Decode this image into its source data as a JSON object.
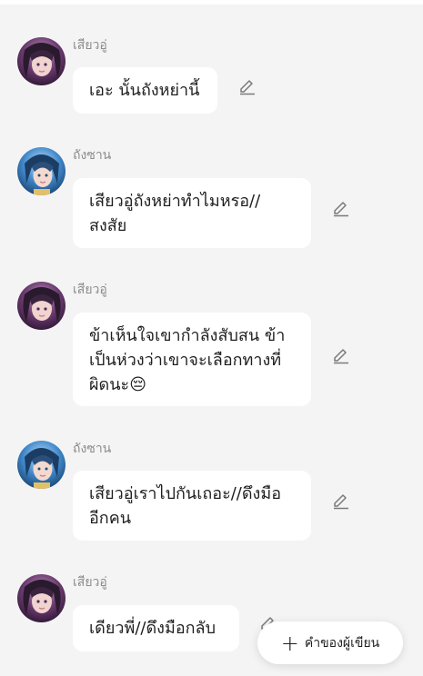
{
  "messages": [
    {
      "sender": "เสียวอู่",
      "avatar_icon": "purple-character-avatar-icon",
      "text": "เอะ นั้นถังหย่านี้"
    },
    {
      "sender": "ถังซาน",
      "avatar_icon": "blue-character-avatar-icon",
      "text": "เสียวอู่ถังหย่าทำไมหรอ// สงสัย"
    },
    {
      "sender": "เสียวอู่",
      "avatar_icon": "purple-character-avatar-icon",
      "text": "ข้าเห็นใจเขากำลังสับสน ข้าเป็นห่วงว่าเขาจะเลือกทางที่ผิดนะ😔"
    },
    {
      "sender": "ถังซาน",
      "avatar_icon": "blue-character-avatar-icon",
      "text": "เสียวอู่เราไปกันเถอะ//ดึงมืออีกคน"
    },
    {
      "sender": "เสียวอู่",
      "avatar_icon": "purple-character-avatar-icon",
      "text": "เดียวพี่//ดึงมือกลับ"
    }
  ],
  "fab": {
    "icon": "plus-icon",
    "label": "คำของผู้เขียน"
  },
  "colors": {
    "background": "#f4f4f4",
    "bubble": "#ffffff",
    "sender_text": "#8c8c8c",
    "message_text": "#1e1e1e",
    "edit_icon": "#7a7a7a"
  }
}
